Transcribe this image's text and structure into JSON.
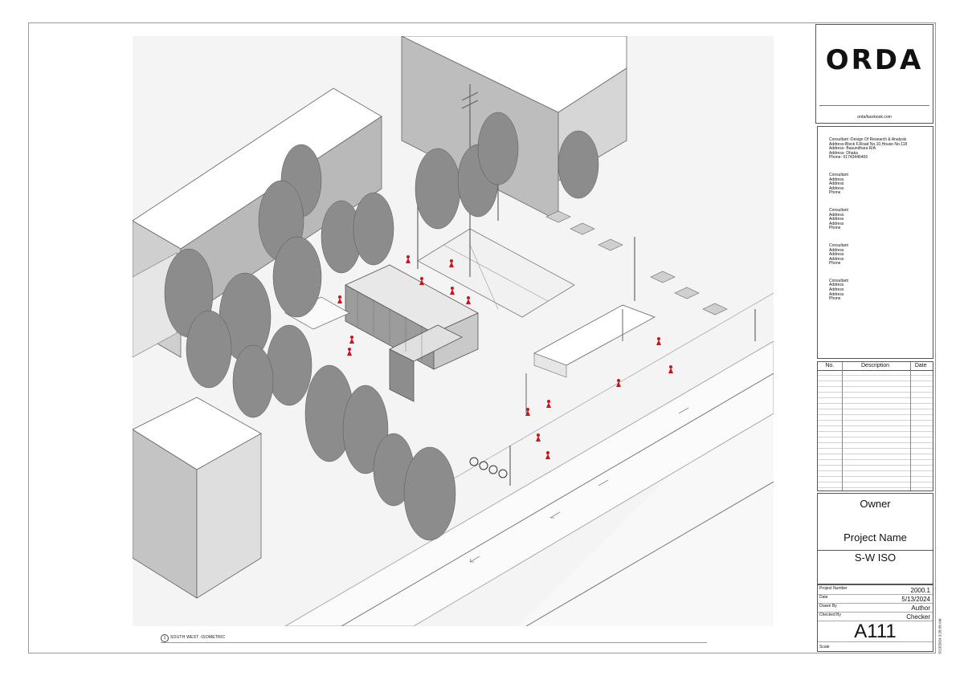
{
  "titleblock": {
    "logo": "ORDA",
    "facebook": "orda/facebook.com",
    "consultants": [
      [
        "Consultant -Design Of Research & Analysis",
        "Address-Block F,Road No.10,House No.118",
        "Address- Basundhara R/A",
        "Address- Dhaka",
        "Phone- 01743446406"
      ],
      [
        "Consultant",
        "Address",
        "Address",
        "Address",
        "Phone"
      ],
      [
        "Consultant",
        "Address",
        "Address",
        "Address",
        "Phone"
      ],
      [
        "Consultant",
        "Address",
        "Address",
        "Address",
        "Phone"
      ],
      [
        "Consultant",
        "Address",
        "Address",
        "Address",
        "Phone"
      ]
    ],
    "revision_headers": {
      "no": "No.",
      "description": "Description",
      "date": "Date"
    },
    "owner": "Owner",
    "project_name": "Project Name",
    "view_name": "S-W ISO",
    "project_number_label": "Project Number",
    "project_number": "2000.1",
    "date_label": "Date",
    "date": "5/13/2024",
    "drawn_by_label": "Drawn By",
    "drawn_by": "Author",
    "checked_by_label": "Checked By",
    "checked_by": "Checker",
    "sheet_number": "A111",
    "scale_label": "Scale",
    "print_stamp": "5/13/2024 3:28:38 AM"
  },
  "viewport": {
    "view_number": "1",
    "view_title": "SOUTH WEST -ISOMETRIC"
  },
  "colors": {
    "accent_figures": "#c8161d",
    "building_fill": "#ffffff",
    "tree_fill": "#8c8c8c",
    "line": "#555555"
  }
}
